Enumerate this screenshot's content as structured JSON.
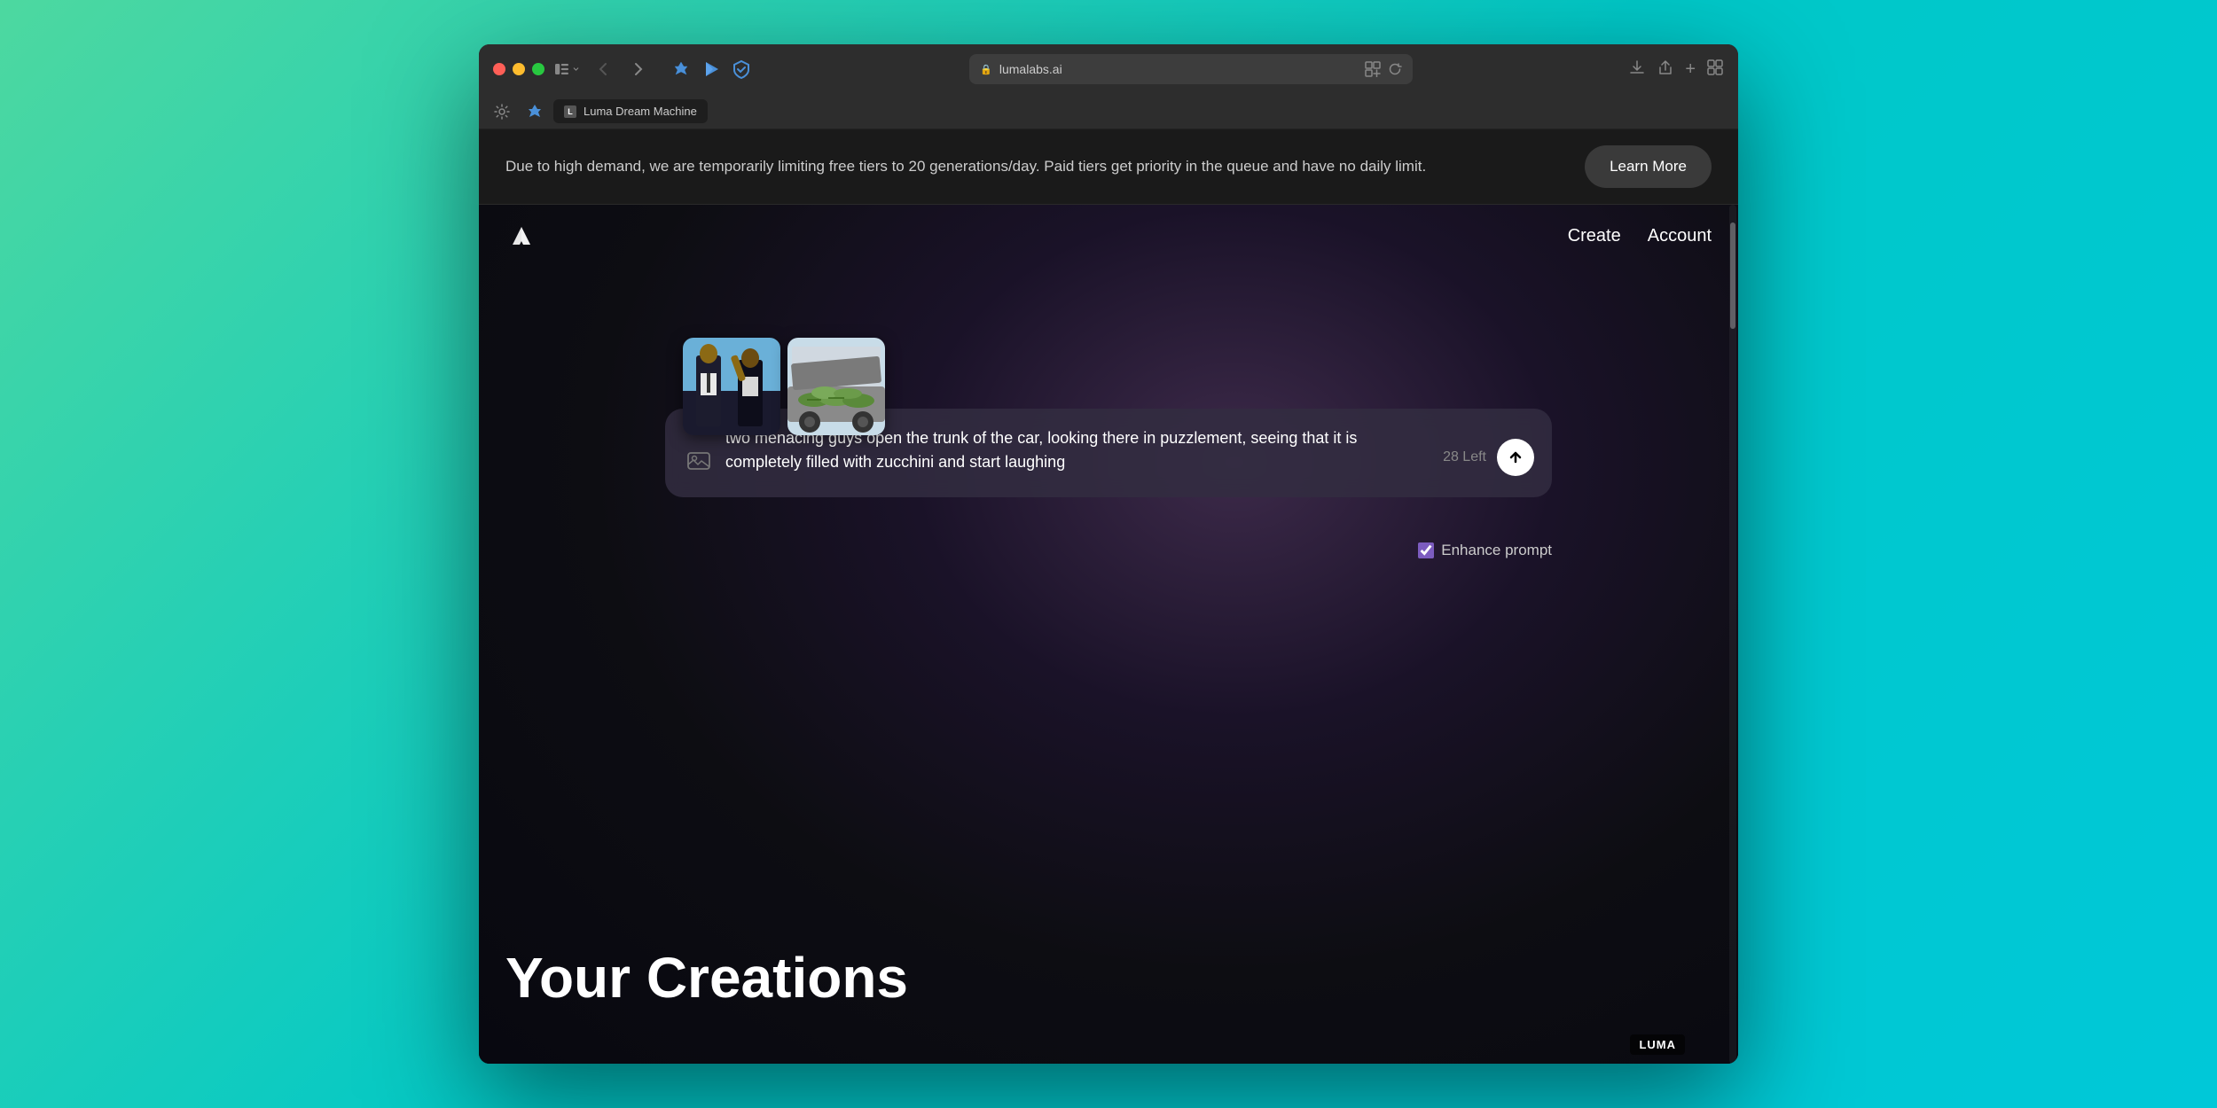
{
  "browser": {
    "url": "lumalabs.ai",
    "tab_title": "Luma Dream Machine",
    "tab_favicon": "L"
  },
  "banner": {
    "message": "Due to high demand, we are temporarily limiting free tiers to 20 generations/day. Paid tiers get priority in the queue and have no daily limit.",
    "learn_more_label": "Learn More"
  },
  "nav": {
    "create_label": "Create",
    "account_label": "Account"
  },
  "prompt": {
    "text": "two menacing guys open the trunk of the car, looking there in puzzlement, seeing that it is completely filled with zucchini and start laughing",
    "chars_left": "28 Left",
    "image_attach_placeholder": "🖼",
    "submit_icon": "↑"
  },
  "enhance": {
    "label": "Enhance prompt",
    "checked": true
  },
  "creations": {
    "title": "Your Creations"
  },
  "watermark": {
    "text": "LUMA"
  }
}
